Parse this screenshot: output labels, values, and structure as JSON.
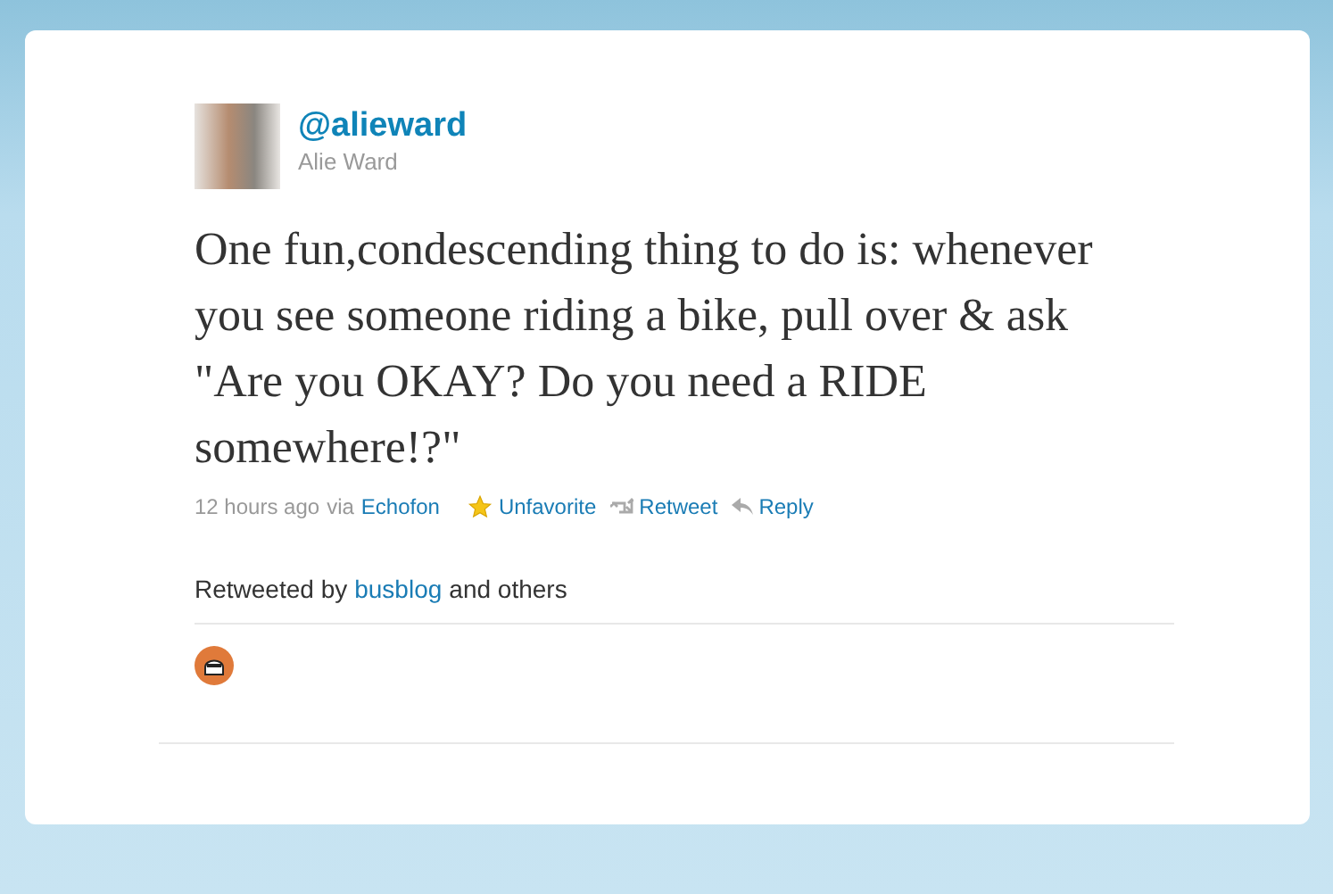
{
  "author": {
    "handle": "@alieward",
    "name": "Alie Ward"
  },
  "tweet": {
    "text": "One fun,condescending thing to do is: whenever you see someone riding a bike, pull over & ask \"Are you OKAY? Do you need a RIDE somewhere!?\""
  },
  "meta": {
    "time": "12 hours ago",
    "via": "via",
    "client": "Echofon"
  },
  "actions": [
    {
      "kind": "favorite",
      "label": "Unfavorite",
      "favorited": true
    },
    {
      "kind": "retweet",
      "label": "Retweet"
    },
    {
      "kind": "reply",
      "label": "Reply"
    }
  ],
  "retweeted": {
    "prefix": "Retweeted by",
    "user": "busblog",
    "suffix": "and others"
  }
}
